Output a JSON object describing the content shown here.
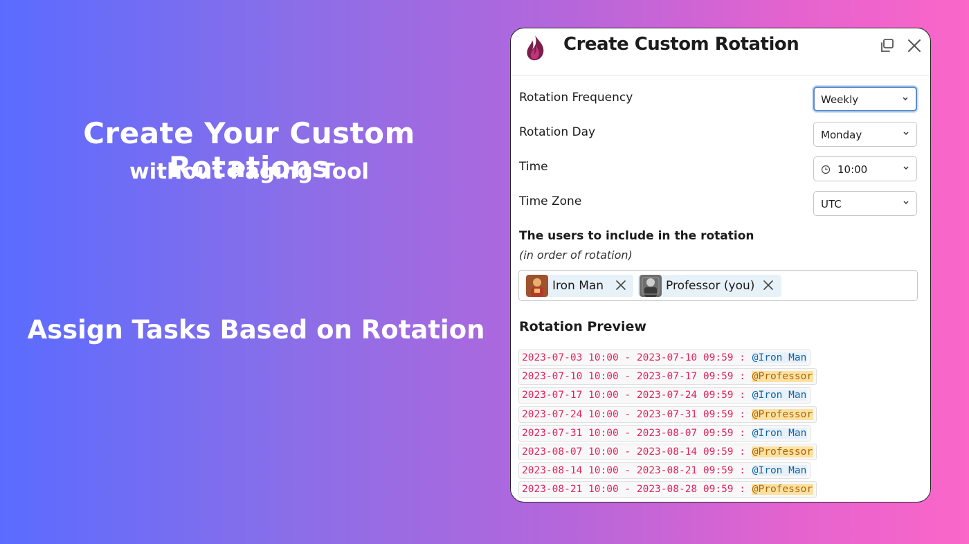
{
  "promo": {
    "title": "Create Your Custom Rotations",
    "subtitle": "without Paging Tool",
    "tagline": "Assign Tasks Based on Rotation"
  },
  "modal": {
    "title": "Create Custom Rotation",
    "cut_off_text": "·",
    "fields": {
      "frequency": {
        "label": "Rotation Frequency",
        "value": "Weekly"
      },
      "day": {
        "label": "Rotation Day",
        "value": "Monday"
      },
      "time": {
        "label": "Time",
        "value": "10:00"
      },
      "timezone": {
        "label": "Time Zone",
        "value": "UTC"
      }
    },
    "users_section": {
      "title": "The users to include in the rotation",
      "subtitle": "(in order of rotation)",
      "users": [
        {
          "name": "Iron Man"
        },
        {
          "name": "Professor (you)"
        }
      ]
    },
    "preview": {
      "title": "Rotation Preview",
      "rows": [
        {
          "range": "2023-07-03 10:00 - 2023-07-10 09:59 :",
          "mention": "@Iron Man"
        },
        {
          "range": "2023-07-10 10:00 - 2023-07-17 09:59 :",
          "mention": "@Professor"
        },
        {
          "range": "2023-07-17 10:00 - 2023-07-24 09:59 :",
          "mention": "@Iron Man"
        },
        {
          "range": "2023-07-24 10:00 - 2023-07-31 09:59 :",
          "mention": "@Professor"
        },
        {
          "range": "2023-07-31 10:00 - 2023-08-07 09:59 :",
          "mention": "@Iron Man"
        },
        {
          "range": "2023-08-07 10:00 - 2023-08-14 09:59 :",
          "mention": "@Professor"
        },
        {
          "range": "2023-08-14 10:00 - 2023-08-21 09:59 :",
          "mention": "@Iron Man"
        },
        {
          "range": "2023-08-21 10:00 - 2023-08-28 09:59 :",
          "mention": "@Professor"
        }
      ]
    }
  },
  "colors": {
    "accent_focus": "#5b8bd0",
    "code_text": "#e0245e",
    "mention_blue": "#1264a3",
    "mention_highlight": "#fbe2a4"
  }
}
